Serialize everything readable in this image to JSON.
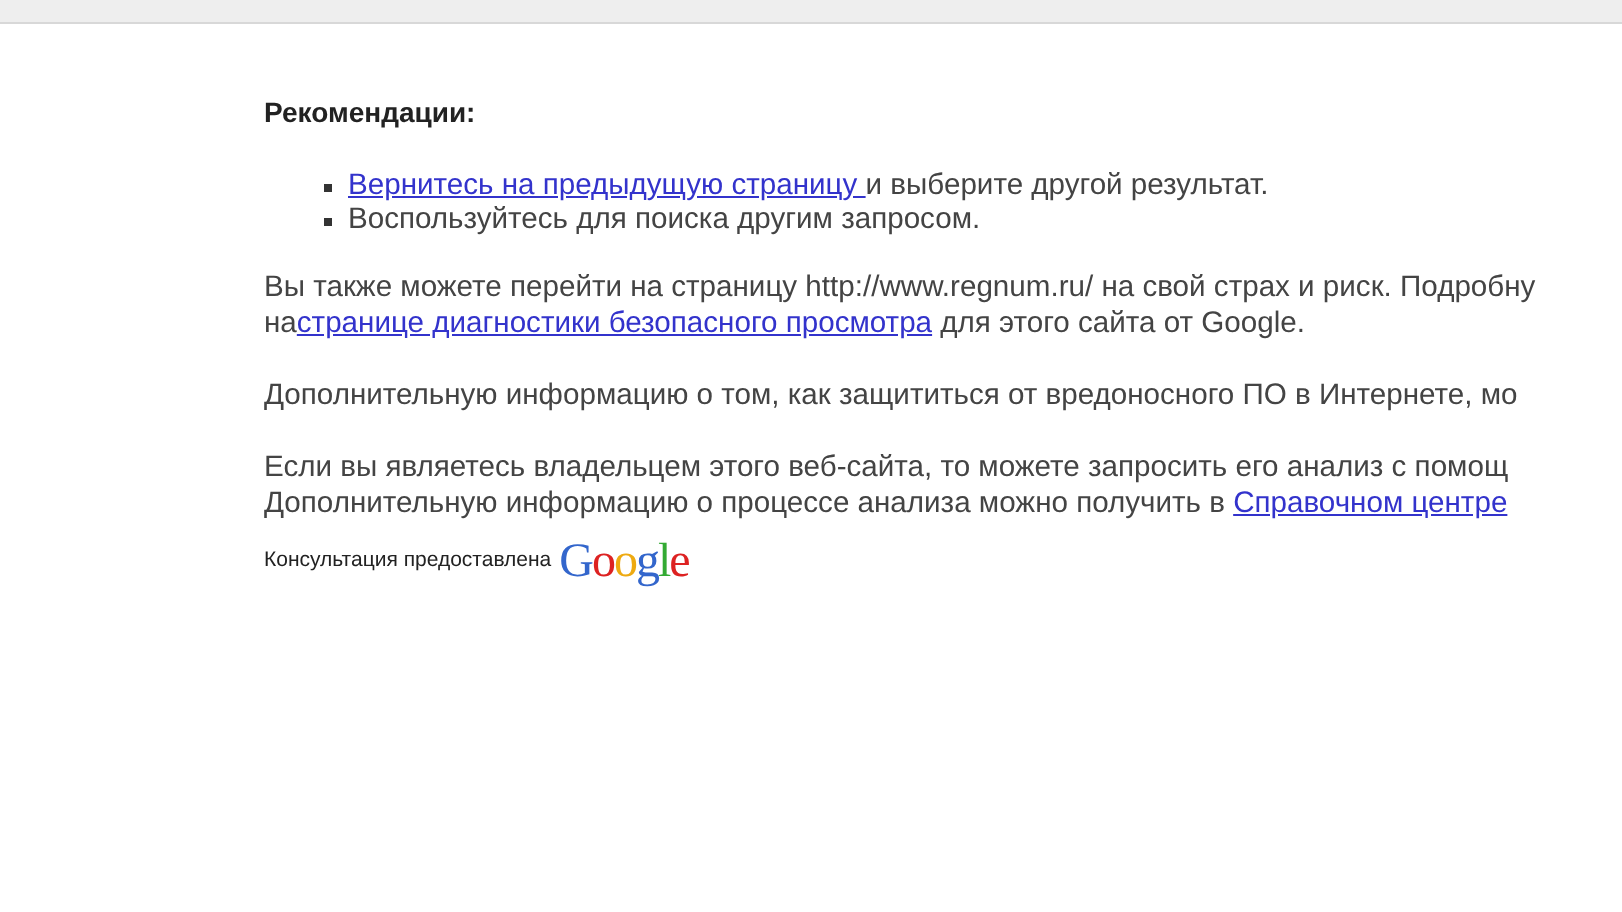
{
  "heading": "Рекомендации:",
  "bullets": [
    {
      "link": "Вернитесь на предыдущую страницу ",
      "text": "и выберите другой результат."
    },
    {
      "text": "Воспользуйтесь для поиска другим запросом."
    }
  ],
  "paragraphs": [
    {
      "lines": [
        {
          "before": "Вы также можете перейти на страницу http://www.regnum.ru/ на свой страх и риск. Подробну"
        },
        {
          "before": "на",
          "link": "странице диагностики безопасного просмотра",
          "after": " для этого сайта от Google."
        }
      ]
    },
    {
      "lines": [
        {
          "before": "Дополнительную информацию о том, как защититься от вредоносного ПО в Интернете, мо"
        }
      ]
    },
    {
      "lines": [
        {
          "before": "Если вы являетесь владельцем этого веб-сайта, то можете запросить его анализ с помощ"
        },
        {
          "before": "Дополнительную информацию о процессе анализа можно получить в ",
          "link": "Справочном центре"
        }
      ]
    }
  ],
  "footer": {
    "text": "Консультация предоставлена",
    "logo": "Google"
  }
}
